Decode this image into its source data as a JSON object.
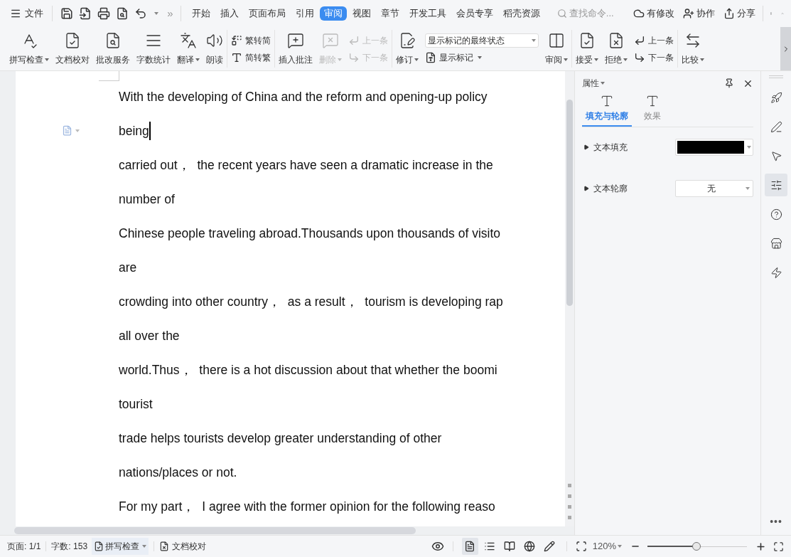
{
  "menu": {
    "label": "文件"
  },
  "overflow": "»",
  "tabs": [
    {
      "label": "开始",
      "selected": false
    },
    {
      "label": "插入",
      "selected": false
    },
    {
      "label": "页面布局",
      "selected": false
    },
    {
      "label": "引用",
      "selected": false
    },
    {
      "label": "审阅",
      "selected": true
    },
    {
      "label": "视图",
      "selected": false
    },
    {
      "label": "章节",
      "selected": false
    },
    {
      "label": "开发工具",
      "selected": false
    },
    {
      "label": "会员专享",
      "selected": false
    },
    {
      "label": "稻壳资源",
      "selected": false
    }
  ],
  "search": {
    "placeholder": "查找命令..."
  },
  "actions": [
    {
      "label": "有修改"
    },
    {
      "label": "协作"
    },
    {
      "label": "分享"
    }
  ],
  "ribbon": [
    {
      "items": [
        {
          "kind": "large",
          "label": "拼写检查",
          "dropdown": true,
          "disabled": false
        },
        {
          "kind": "large",
          "label": "文档校对",
          "dropdown": false,
          "disabled": false
        },
        {
          "kind": "large",
          "label": "批改服务",
          "dropdown": false,
          "disabled": false
        },
        {
          "kind": "large",
          "label": "字数统计",
          "dropdown": false,
          "disabled": false
        },
        {
          "kind": "large",
          "label": "翻译",
          "dropdown": true,
          "disabled": false
        },
        {
          "kind": "large",
          "label": "朗读",
          "dropdown": false,
          "disabled": false
        }
      ]
    },
    {
      "items": [
        {
          "kind": "stack",
          "buttons": [
            {
              "label": "繁转简",
              "disabled": false
            },
            {
              "label": "简转繁",
              "disabled": false
            }
          ]
        }
      ]
    },
    {
      "items": [
        {
          "kind": "large",
          "label": "插入批注",
          "dropdown": false,
          "disabled": false
        },
        {
          "kind": "large",
          "label": "删除",
          "dropdown": true,
          "disabled": true
        },
        {
          "kind": "stack",
          "buttons": [
            {
              "label": "上一条",
              "disabled": true
            },
            {
              "label": "下一条",
              "disabled": true
            }
          ]
        }
      ]
    },
    {
      "items": [
        {
          "kind": "large",
          "label": "修订",
          "dropdown": true,
          "disabled": false
        },
        {
          "kind": "combo",
          "value": "显示标记的最终状态",
          "button": "显示标记"
        },
        {
          "kind": "large",
          "label": "审阅",
          "dropdown": true,
          "disabled": false
        }
      ]
    },
    {
      "items": [
        {
          "kind": "large",
          "label": "接受",
          "dropdown": true,
          "disabled": false
        },
        {
          "kind": "large",
          "label": "拒绝",
          "dropdown": true,
          "disabled": false
        },
        {
          "kind": "stack",
          "buttons": [
            {
              "label": "上一条",
              "disabled": false
            },
            {
              "label": "下一条",
              "disabled": false
            }
          ]
        }
      ]
    },
    {
      "items": [
        {
          "kind": "large",
          "label": "比较",
          "dropdown": true,
          "disabled": false
        }
      ]
    }
  ],
  "document": {
    "lines": [
      {
        "text": "With the developing of China and the reform and opening-up policy",
        "caret": false
      },
      {
        "text": "being",
        "caret": true
      },
      {
        "text": "carried out，  the recent years have seen a dramatic increase in the",
        "caret": false
      },
      {
        "text": "number of",
        "caret": false
      },
      {
        "text": "Chinese people traveling abroad.Thousands upon thousands of visito",
        "caret": false
      },
      {
        "text": "are",
        "caret": false
      },
      {
        "text": "crowding into other country，  as a result，  tourism is developing rap",
        "caret": false
      },
      {
        "text": "all over the",
        "caret": false
      },
      {
        "text": "world.Thus，  there is a hot discussion about that whether the boomi",
        "caret": false
      },
      {
        "text": "tourist",
        "caret": false
      },
      {
        "text": "trade helps tourists develop greater understanding of other",
        "caret": false
      },
      {
        "text": "nations/places or not.",
        "caret": false
      },
      {
        "text": "For my part，  I agree with the former opinion for the following reaso",
        "caret": false
      }
    ]
  },
  "panel": {
    "title": "属性",
    "tabs": [
      {
        "label": "填充与轮廓",
        "selected": true
      },
      {
        "label": "效果",
        "selected": false
      }
    ],
    "rows": [
      {
        "kind": "color",
        "label": "文本填充",
        "expanded": false,
        "color": "#000000"
      },
      {
        "kind": "select",
        "label": "文本轮廓",
        "expanded": false,
        "value": "无"
      }
    ]
  },
  "side_more": "•••",
  "side_tools": [
    {
      "selected": false
    },
    {
      "selected": false
    },
    {
      "selected": false
    },
    {
      "selected": true
    },
    {
      "selected": false
    },
    {
      "selected": false
    },
    {
      "selected": false
    }
  ],
  "status_bar": {
    "page": "页面: 1/1",
    "words": "字数: 153",
    "spell": "拼写检查",
    "proof": "文档校对",
    "view_modes": [
      {
        "selected": true
      },
      {
        "selected": false
      },
      {
        "selected": false
      },
      {
        "selected": false
      },
      {
        "selected": false
      }
    ],
    "zoom": "120%",
    "zoom_slider": {
      "level": 0.49
    }
  }
}
